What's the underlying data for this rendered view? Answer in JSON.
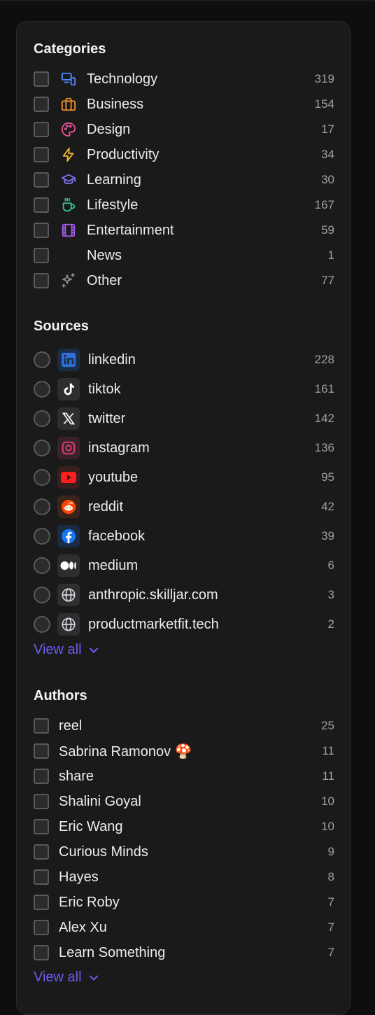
{
  "categories": {
    "title": "Categories",
    "items": [
      {
        "label": "Technology",
        "count": "319",
        "icon": "monitor-phone-icon",
        "color": "#4f8cff"
      },
      {
        "label": "Business",
        "count": "154",
        "icon": "briefcase-icon",
        "color": "#f0902a"
      },
      {
        "label": "Design",
        "count": "17",
        "icon": "palette-icon",
        "color": "#ef4f9a"
      },
      {
        "label": "Productivity",
        "count": "34",
        "icon": "lightning-icon",
        "color": "#f0b62a"
      },
      {
        "label": "Learning",
        "count": "30",
        "icon": "graduation-cap-icon",
        "color": "#7b74f0"
      },
      {
        "label": "Lifestyle",
        "count": "167",
        "icon": "coffee-cup-icon",
        "color": "#35c58a"
      },
      {
        "label": "Entertainment",
        "count": "59",
        "icon": "film-icon",
        "color": "#a45cf0"
      },
      {
        "label": "News",
        "count": "1",
        "icon": "",
        "color": ""
      },
      {
        "label": "Other",
        "count": "77",
        "icon": "sparkles-icon",
        "color": "#8a8a90"
      }
    ]
  },
  "sources": {
    "title": "Sources",
    "items": [
      {
        "label": "linkedin",
        "count": "228",
        "icon": "linkedin-icon"
      },
      {
        "label": "tiktok",
        "count": "161",
        "icon": "tiktok-icon"
      },
      {
        "label": "twitter",
        "count": "142",
        "icon": "x-twitter-icon"
      },
      {
        "label": "instagram",
        "count": "136",
        "icon": "instagram-icon"
      },
      {
        "label": "youtube",
        "count": "95",
        "icon": "youtube-icon"
      },
      {
        "label": "reddit",
        "count": "42",
        "icon": "reddit-icon"
      },
      {
        "label": "facebook",
        "count": "39",
        "icon": "facebook-icon"
      },
      {
        "label": "medium",
        "count": "6",
        "icon": "medium-icon"
      },
      {
        "label": "anthropic.skilljar.com",
        "count": "3",
        "icon": "globe-icon"
      },
      {
        "label": "productmarketfit.tech",
        "count": "2",
        "icon": "globe-icon"
      }
    ],
    "view_all": "View all"
  },
  "authors": {
    "title": "Authors",
    "items": [
      {
        "label": "reel",
        "count": "25"
      },
      {
        "label": "Sabrina Ramonov 🍄",
        "count": "11"
      },
      {
        "label": "share",
        "count": "11"
      },
      {
        "label": "Shalini Goyal",
        "count": "10"
      },
      {
        "label": "Eric Wang",
        "count": "10"
      },
      {
        "label": "Curious Minds",
        "count": "9"
      },
      {
        "label": "Hayes",
        "count": "8"
      },
      {
        "label": "Eric Roby",
        "count": "7"
      },
      {
        "label": "Alex Xu",
        "count": "7"
      },
      {
        "label": "Learn Something",
        "count": "7"
      }
    ],
    "view_all": "View all"
  },
  "colors": {
    "accent": "#6a5cf0",
    "panel_bg": "#1a1a1b",
    "page_bg": "#0e0e0f"
  }
}
